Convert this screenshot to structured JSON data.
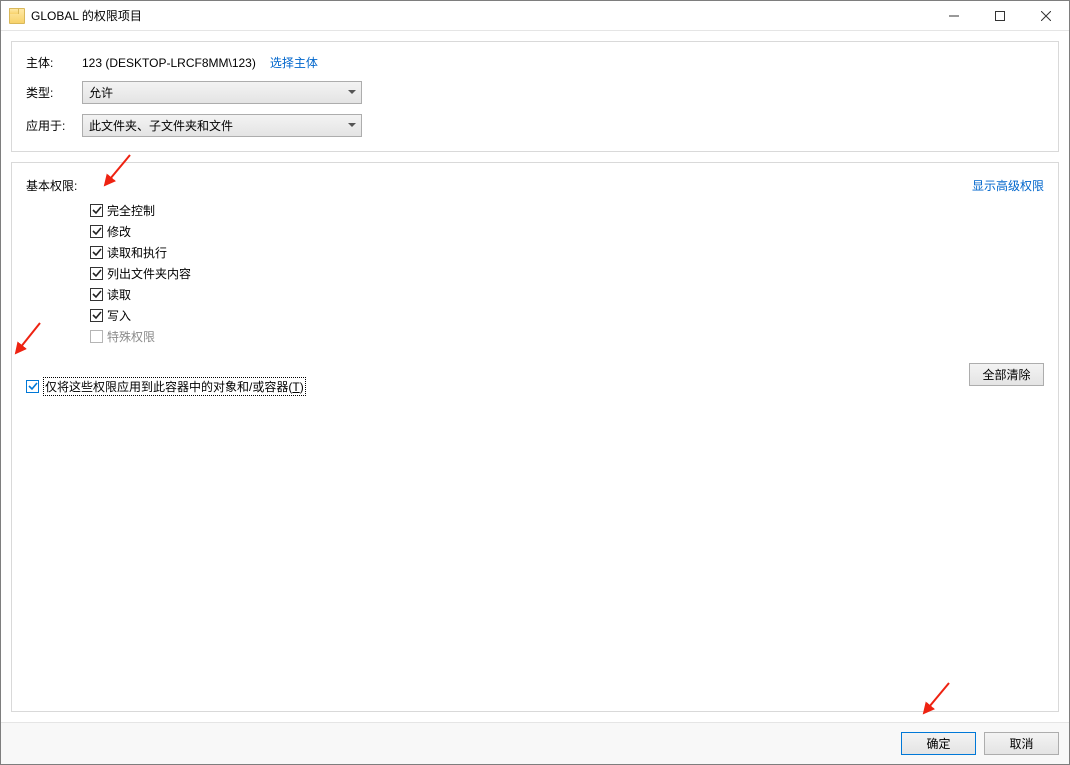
{
  "window": {
    "title": "GLOBAL 的权限项目"
  },
  "form": {
    "principal_label": "主体:",
    "principal_value": "123 (DESKTOP-LRCF8MM\\123)",
    "select_principal_link": "选择主体",
    "type_label": "类型:",
    "type_value": "允许",
    "applies_to_label": "应用于:",
    "applies_to_value": "此文件夹、子文件夹和文件"
  },
  "permissions": {
    "basic_label": "基本权限:",
    "show_advanced_link": "显示高级权限",
    "items": [
      {
        "label": "完全控制",
        "checked": true,
        "disabled": false
      },
      {
        "label": "修改",
        "checked": true,
        "disabled": false
      },
      {
        "label": "读取和执行",
        "checked": true,
        "disabled": false
      },
      {
        "label": "列出文件夹内容",
        "checked": true,
        "disabled": false
      },
      {
        "label": "读取",
        "checked": true,
        "disabled": false
      },
      {
        "label": "写入",
        "checked": true,
        "disabled": false
      },
      {
        "label": "特殊权限",
        "checked": false,
        "disabled": true
      }
    ],
    "apply_only_checkbox_checked": true,
    "apply_only_label_main": "仅将这些权限应用到此容器中的对象和/或容器(",
    "apply_only_hotkey": "T",
    "apply_only_label_end": ")",
    "clear_all_label": "全部清除"
  },
  "footer": {
    "ok_label": "确定",
    "cancel_label": "取消"
  }
}
